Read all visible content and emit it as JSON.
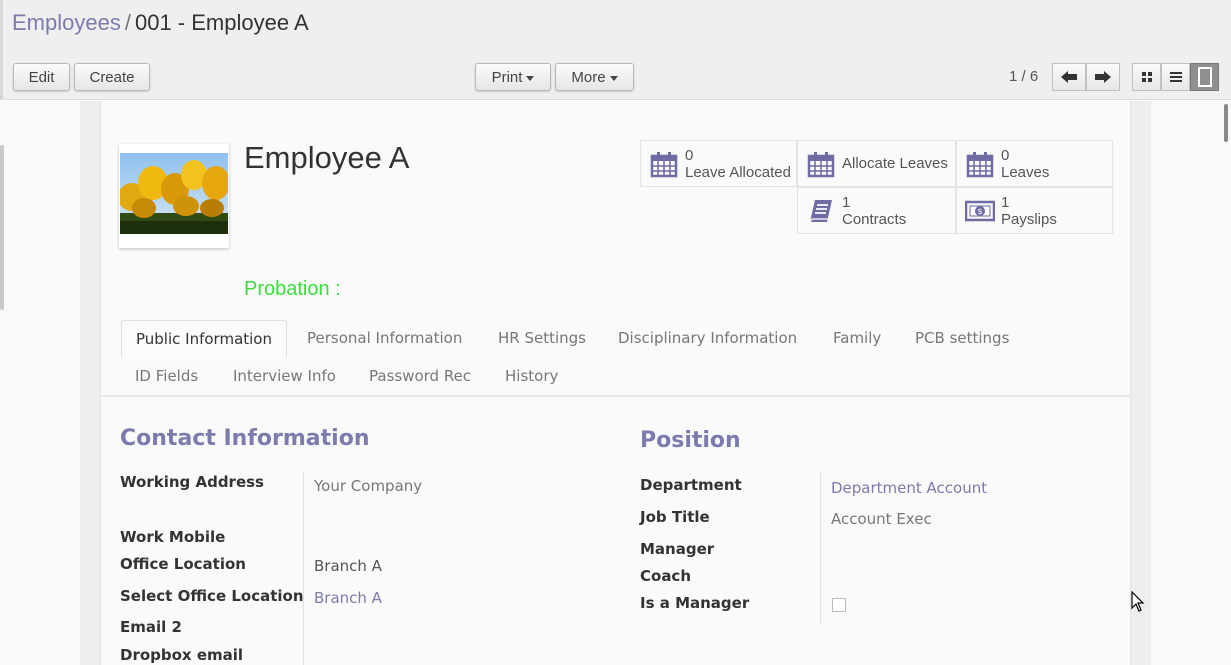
{
  "breadcrumb": {
    "parent": "Employees",
    "separator": "/",
    "current": "001 - Employee A"
  },
  "toolbar": {
    "edit_label": "Edit",
    "create_label": "Create",
    "print_label": "Print",
    "more_label": "More",
    "pager_value": "1 / 6",
    "prev_icon": "arrow-left-icon",
    "next_icon": "arrow-right-icon",
    "views": [
      "kanban-view-icon",
      "list-view-icon",
      "form-view-icon"
    ],
    "active_view": "form"
  },
  "employee": {
    "name": "Employee A",
    "photo": "yellow tulips photo",
    "probation_label": "Probation :",
    "probation_color": "#3bdf3b"
  },
  "stat_buttons": [
    {
      "icon": "calendar-icon",
      "value": "0",
      "label": "Leave Allocated"
    },
    {
      "icon": "calendar-icon",
      "value": "",
      "label": "Allocate Leaves"
    },
    {
      "icon": "calendar-icon",
      "value": "0",
      "label": "Leaves"
    },
    {
      "icon": "book-icon",
      "value": "1",
      "label": "Contracts"
    },
    {
      "icon": "money-icon",
      "value": "1",
      "label": "Payslips"
    }
  ],
  "tabs": [
    {
      "label": "Public Information",
      "active": true
    },
    {
      "label": "Personal Information"
    },
    {
      "label": "HR Settings"
    },
    {
      "label": "Disciplinary Information"
    },
    {
      "label": "Family"
    },
    {
      "label": "PCB settings"
    },
    {
      "label": "ID Fields"
    },
    {
      "label": "Interview Info"
    },
    {
      "label": "Password Rec"
    },
    {
      "label": "History"
    }
  ],
  "contact": {
    "title": "Contact Information",
    "fields": [
      {
        "label": "Working Address",
        "value": "Your Company"
      },
      {
        "label": "Work Mobile",
        "value": ""
      },
      {
        "label": "Office Location",
        "value": "Branch A"
      },
      {
        "label": "Select Office Location",
        "value": "Branch A"
      },
      {
        "label": "Email 2",
        "value": ""
      },
      {
        "label": "Dropbox email",
        "value": ""
      }
    ]
  },
  "position": {
    "title": "Position",
    "fields": [
      {
        "label": "Department",
        "value": "Department Account"
      },
      {
        "label": "Job Title",
        "value": "Account Exec"
      },
      {
        "label": "Manager",
        "value": ""
      },
      {
        "label": "Coach",
        "value": ""
      },
      {
        "label": "Is a Manager",
        "value": false
      }
    ]
  },
  "colors": {
    "accent": "#7c7bad",
    "text": "#333333"
  }
}
